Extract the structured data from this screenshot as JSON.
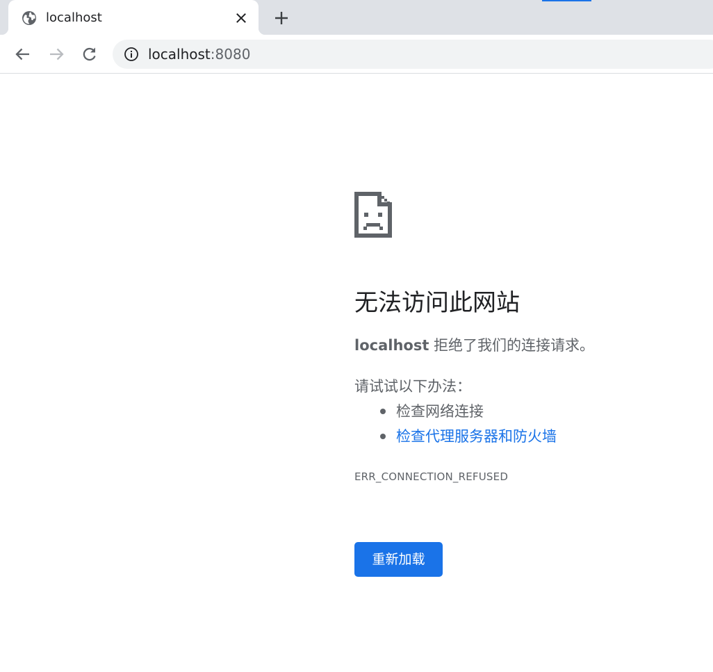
{
  "browser": {
    "accent_color": "#1a73e8",
    "tab": {
      "title": "localhost",
      "favicon": "globe-icon",
      "close_icon": "close-icon"
    },
    "new_tab_icon": "plus-icon",
    "toolbar": {
      "back_icon": "arrow-left-icon",
      "forward_icon": "arrow-right-icon",
      "reload_icon": "reload-icon",
      "site_info_icon": "info-icon",
      "url_host": "localhost",
      "url_port": ":8080"
    }
  },
  "error_page": {
    "icon": "sad-page-icon",
    "heading": "无法访问此网站",
    "summary_host": "localhost",
    "summary_text": " 拒绝了我们的连接请求。",
    "suggestions_title": "请试试以下办法：",
    "suggestions": [
      {
        "text": "检查网络连接",
        "is_link": false
      },
      {
        "text": "检查代理服务器和防火墙",
        "is_link": true
      }
    ],
    "error_code": "ERR_CONNECTION_REFUSED",
    "reload_button_label": "重新加载",
    "link_color": "#1a73e8",
    "text_color": "#5f6368"
  }
}
